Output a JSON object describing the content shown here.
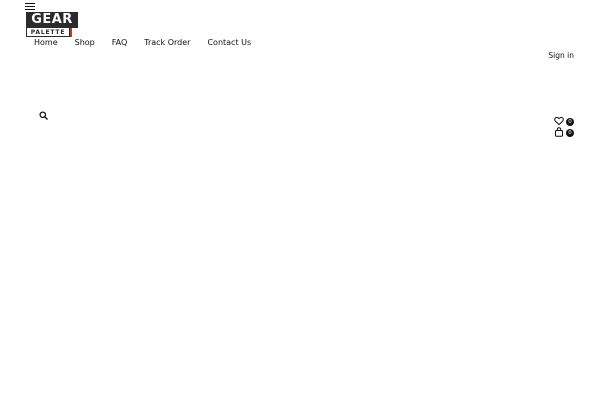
{
  "header": {
    "logo": {
      "top_text": "GEAR",
      "bottom_text": "PALETTE"
    },
    "menu_icon": "hamburger-icon",
    "nav": {
      "items": [
        {
          "label": "Home"
        },
        {
          "label": "Shop"
        },
        {
          "label": "FAQ"
        },
        {
          "label": "Track Order"
        },
        {
          "label": "Contact Us"
        }
      ]
    },
    "account": {
      "signin_label": "Sign in"
    },
    "search_icon": "search-icon",
    "wishlist": {
      "icon": "heart-icon",
      "count": "0"
    },
    "cart": {
      "icon": "shopping-bag-icon",
      "count": "0"
    }
  },
  "colors": {
    "background": "#ffffff",
    "text": "#111111",
    "logo_dark": "#2b2b2b",
    "logo_accent": "#c0392b",
    "badge_bg": "#111111",
    "badge_text": "#ffffff"
  }
}
